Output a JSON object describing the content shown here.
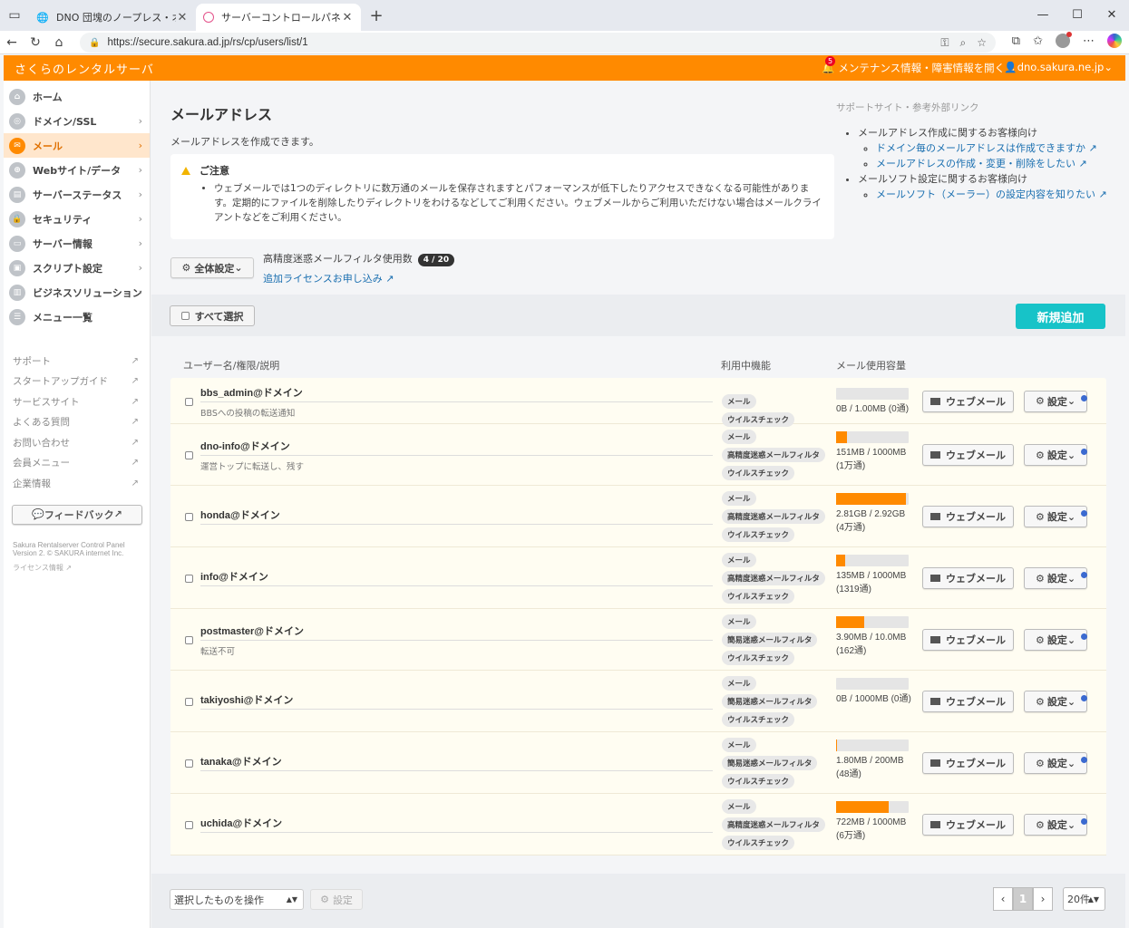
{
  "browser": {
    "tabs": [
      {
        "title": "DNO 団塊のノープレス・オブリージュ"
      },
      {
        "title": "サーバーコントロールパネル"
      }
    ],
    "url": "https://secure.sakura.ad.jp/rs/cp/users/list/1"
  },
  "header": {
    "brand": "さくらのレンタルサーバ",
    "notice_count": "5",
    "maintenance": "メンテナンス情報・障害情報を開く",
    "user": "dno.sakura.ne.jp"
  },
  "sidebar": {
    "items": [
      {
        "label": "ホーム",
        "icon": "home-icon"
      },
      {
        "label": "ドメイン/SSL",
        "icon": "globe-icon"
      },
      {
        "label": "メール",
        "icon": "mail-icon",
        "active": true
      },
      {
        "label": "Webサイト/データ",
        "icon": "web-icon"
      },
      {
        "label": "サーバーステータス",
        "icon": "chart-icon"
      },
      {
        "label": "セキュリティ",
        "icon": "lock-icon"
      },
      {
        "label": "サーバー情報",
        "icon": "server-icon"
      },
      {
        "label": "スクリプト設定",
        "icon": "script-icon"
      },
      {
        "label": "ビジネスソリューション",
        "icon": "building-icon"
      },
      {
        "label": "メニュー一覧",
        "icon": "list-icon"
      }
    ],
    "links": [
      "サポート",
      "スタートアップガイド",
      "サービスサイト",
      "よくある質問",
      "お問い合わせ",
      "会員メニュー",
      "企業情報"
    ],
    "feedback": "フィードバック",
    "copyright_1": "Sakura Rentalserver Control Panel",
    "copyright_2": "Version 2. © SAKURA internet Inc.",
    "license": "ライセンス情報"
  },
  "main": {
    "title": "メールアドレス",
    "description": "メールアドレスを作成できます。",
    "notice_title": "ご注意",
    "notice_text": "ウェブメールでは1つのディレクトリに数万通のメールを保存されますとパフォーマンスが低下したりアクセスできなくなる可能性があります。定期的にファイルを削除したりディレクトリをわけるなどしてご利用ください。ウェブメールからご利用いただけない場合はメールクライアントなどをご利用ください。",
    "global_settings": "全体設定",
    "filter_label": "高精度迷惑メールフィルタ使用数",
    "filter_count": "4 / 20",
    "license_link": "追加ライセンスお申し込み",
    "select_all": "すべて選択",
    "add_new": "新規追加",
    "col_user": "ユーザー名/権限/説明",
    "col_features": "利用中機能",
    "col_usage": "メール使用容量",
    "webmail": "ウェブメール",
    "settings": "設定"
  },
  "support": {
    "title": "サポートサイト・参考外部リンク",
    "group1": "メールアドレス作成に関するお客様向け",
    "link1": "ドメイン毎のメールアドレスは作成できますか",
    "link2": "メールアドレスの作成・変更・削除をしたい",
    "group2": "メールソフト設定に関するお客様向け",
    "link3": "メールソフト（メーラー）の設定内容を知りたい"
  },
  "users": [
    {
      "name": "bbs_admin@ドメイン",
      "desc": "BBSへの投稿の転送通知",
      "tags": [
        "メール",
        "ウイルスチェック"
      ],
      "usage_text": "0B / 1.00MB (0通)",
      "usage_pct": 0
    },
    {
      "name": "dno-info@ドメイン",
      "desc": "運営トップに転送し、残す",
      "tags": [
        "メール",
        "高精度迷惑メールフィルタ",
        "ウイルスチェック"
      ],
      "usage_text": "151MB / 1000MB (1万通)",
      "usage_pct": 15
    },
    {
      "name": "honda@ドメイン",
      "desc": "",
      "tags": [
        "メール",
        "高精度迷惑メールフィルタ",
        "ウイルスチェック"
      ],
      "usage_text": "2.81GB / 2.92GB (4万通)",
      "usage_pct": 96
    },
    {
      "name": "info@ドメイン",
      "desc": "",
      "tags": [
        "メール",
        "高精度迷惑メールフィルタ",
        "ウイルスチェック"
      ],
      "usage_text": "135MB / 1000MB (1319通)",
      "usage_pct": 13
    },
    {
      "name": "postmaster@ドメイン",
      "desc": "転送不可",
      "tags": [
        "メール",
        "簡易迷惑メールフィルタ",
        "ウイルスチェック"
      ],
      "usage_text": "3.90MB / 10.0MB (162通)",
      "usage_pct": 39
    },
    {
      "name": "takiyoshi@ドメイン",
      "desc": "",
      "tags": [
        "メール",
        "簡易迷惑メールフィルタ",
        "ウイルスチェック"
      ],
      "usage_text": "0B / 1000MB (0通)",
      "usage_pct": 0
    },
    {
      "name": "tanaka@ドメイン",
      "desc": "",
      "tags": [
        "メール",
        "簡易迷惑メールフィルタ",
        "ウイルスチェック"
      ],
      "usage_text": "1.80MB / 200MB (48通)",
      "usage_pct": 1
    },
    {
      "name": "uchida@ドメイン",
      "desc": "",
      "tags": [
        "メール",
        "高精度迷惑メールフィルタ",
        "ウイルスチェック"
      ],
      "usage_text": "722MB / 1000MB (6万通)",
      "usage_pct": 72
    }
  ],
  "footer": {
    "operation_select": "選択したものを操作",
    "apply": "設定",
    "page": "1",
    "per_page": "20件"
  },
  "colors": {
    "accent": "#ff8a00",
    "add_button": "#17c3c8",
    "link": "#1a6fb0"
  }
}
